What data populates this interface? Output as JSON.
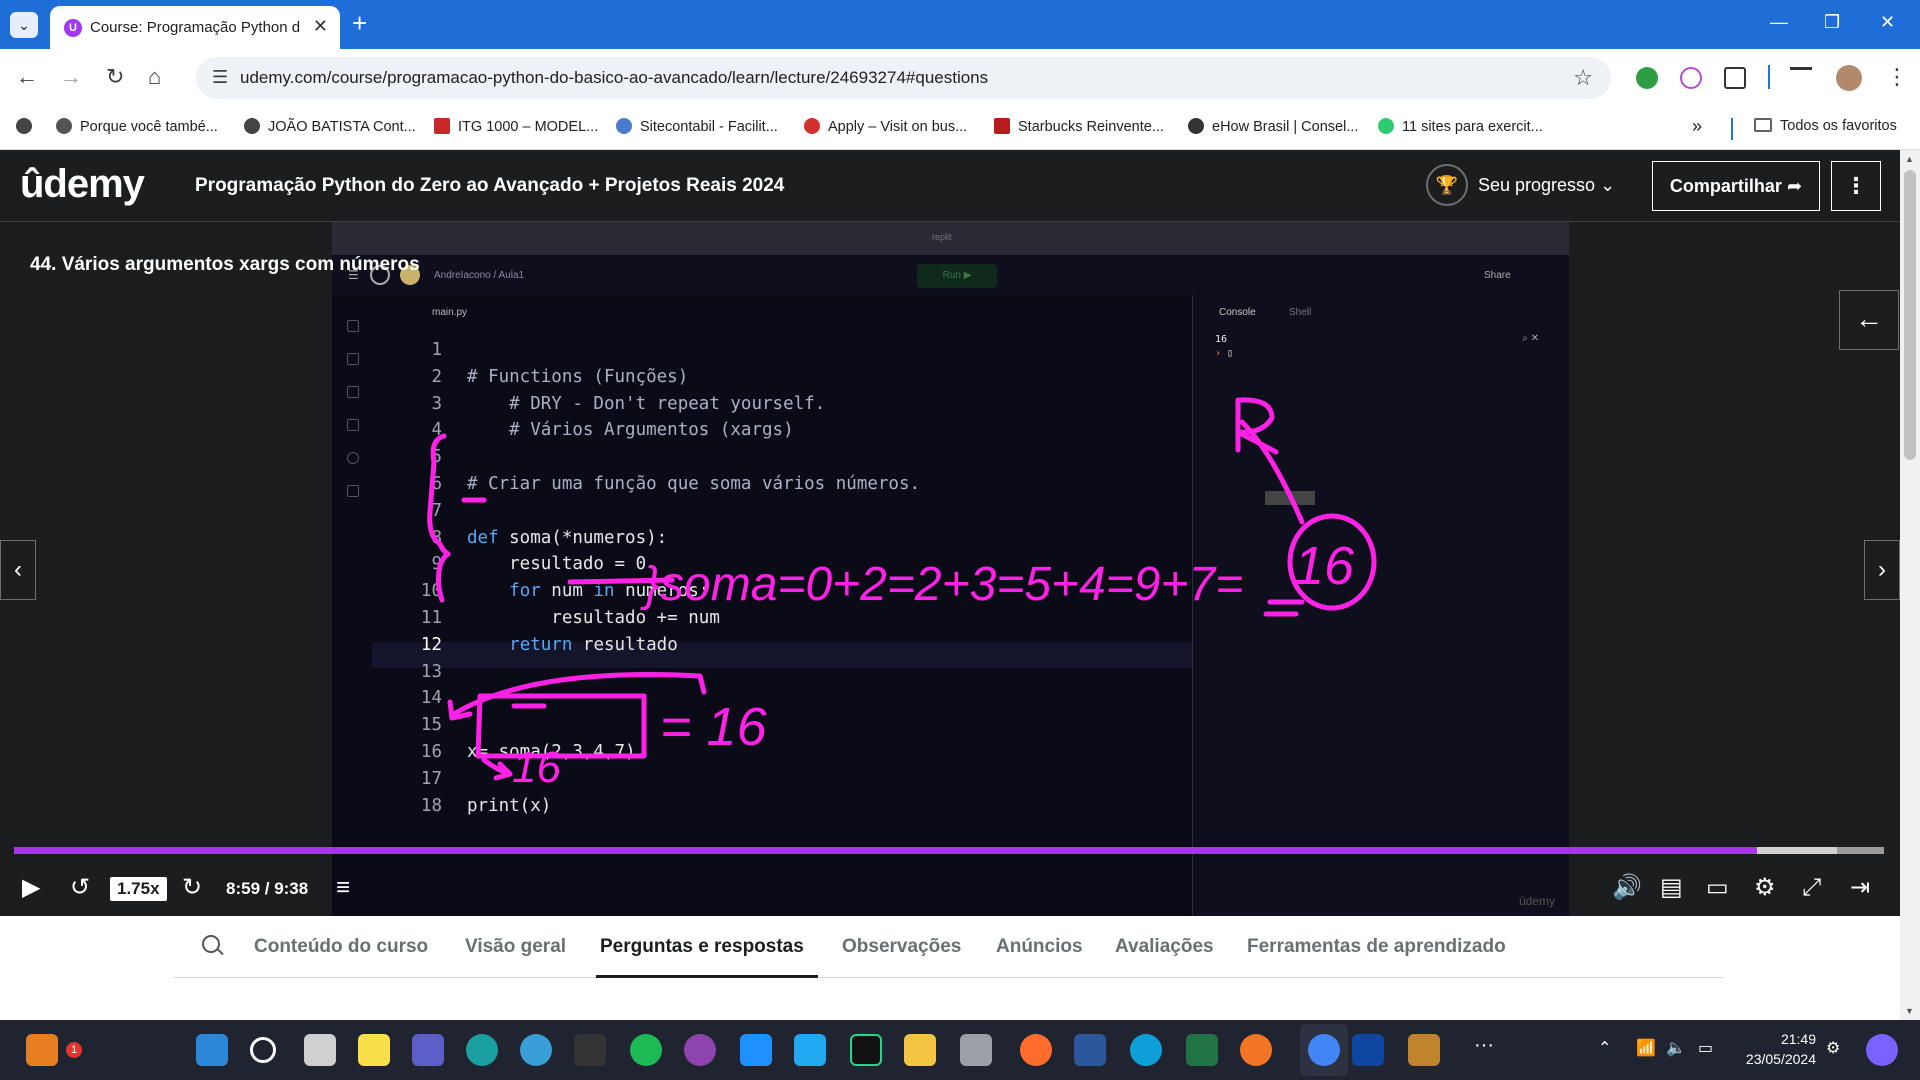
{
  "browser": {
    "tab_title": "Course: Programação Python do Zero ao Avançado",
    "url": "udemy.com/course/programacao-python-do-basico-ao-avancado/learn/lecture/24693274#questions",
    "bookmarks": [
      {
        "label": "Porque você també...",
        "color": "#555555"
      },
      {
        "label": "JOÃO BATISTA Cont...",
        "color": "#444444"
      },
      {
        "label": "ITG 1000 – MODEL...",
        "color": "#c62828"
      },
      {
        "label": "Sitecontabil - Facilit...",
        "color": "#4a7bd0"
      },
      {
        "label": "Apply – Visit on bus...",
        "color": "#d32f2f"
      },
      {
        "label": "Starbucks Reinvente...",
        "color": "#b71c1c"
      },
      {
        "label": "eHow Brasil | Consel...",
        "color": "#333333"
      },
      {
        "label": "11 sites para exercit...",
        "color": "#2ecc71"
      }
    ],
    "favorites_label": "Todos os favoritos"
  },
  "udemy": {
    "logo": "ûdemy",
    "course_title": "Programação Python do Zero ao Avançado + Projetos Reais 2024",
    "progress_label": "Seu progresso",
    "share_label": "Compartilhar",
    "lecture_title": "44. Vários argumentos xargs com números"
  },
  "replit": {
    "top_label": "replit",
    "crumb": "AndreIacono / Aula1",
    "run_label": "Run ▶",
    "share_label": "Share",
    "file_tab": "main.py",
    "console_tab": "Console",
    "shell_tab": "Shell",
    "console_output": "16",
    "watermark": "ûdemy"
  },
  "code_lines": [
    {
      "n": "1",
      "t": ""
    },
    {
      "n": "2",
      "t": "# Functions (Funções)"
    },
    {
      "n": "3",
      "t": "    # DRY - Don't repeat yourself."
    },
    {
      "n": "4",
      "t": "    # Vários Argumentos (xargs)"
    },
    {
      "n": "5",
      "t": ""
    },
    {
      "n": "6",
      "t": "# Criar uma função que soma vários números."
    },
    {
      "n": "7",
      "t": ""
    },
    {
      "n": "8",
      "t": "def soma(*numeros):"
    },
    {
      "n": "9",
      "t": "    resultado = 0"
    },
    {
      "n": "10",
      "t": "    for num in numeros:"
    },
    {
      "n": "11",
      "t": "        resultado += num"
    },
    {
      "n": "12",
      "t": "    return resultado"
    },
    {
      "n": "13",
      "t": ""
    },
    {
      "n": "14",
      "t": ""
    },
    {
      "n": "15",
      "t": ""
    },
    {
      "n": "16",
      "t": "x= soma(2,3,4,7)"
    },
    {
      "n": "17",
      "t": ""
    },
    {
      "n": "18",
      "t": "print(x)"
    }
  ],
  "annotations": {
    "sum_chain": "}soma=0+2=2+3=5+4=9+7=",
    "result": "16",
    "equals_16": "= 16",
    "below_print": "16"
  },
  "player": {
    "speed": "1.75x",
    "time": "8:59 / 9:38",
    "progress": 0.932,
    "buffered": 0.975,
    "accent": "#a435f0"
  },
  "tabs": [
    {
      "label": "Conteúdo do curso",
      "active": false
    },
    {
      "label": "Visão geral",
      "active": false
    },
    {
      "label": "Perguntas e respostas",
      "active": true
    },
    {
      "label": "Observações",
      "active": false
    },
    {
      "label": "Anúncios",
      "active": false
    },
    {
      "label": "Avaliações",
      "active": false
    },
    {
      "label": "Ferramentas de aprendizado",
      "active": false
    }
  ],
  "taskbar": {
    "time": "21:49",
    "date": "23/05/2024",
    "notification_count": "1"
  }
}
